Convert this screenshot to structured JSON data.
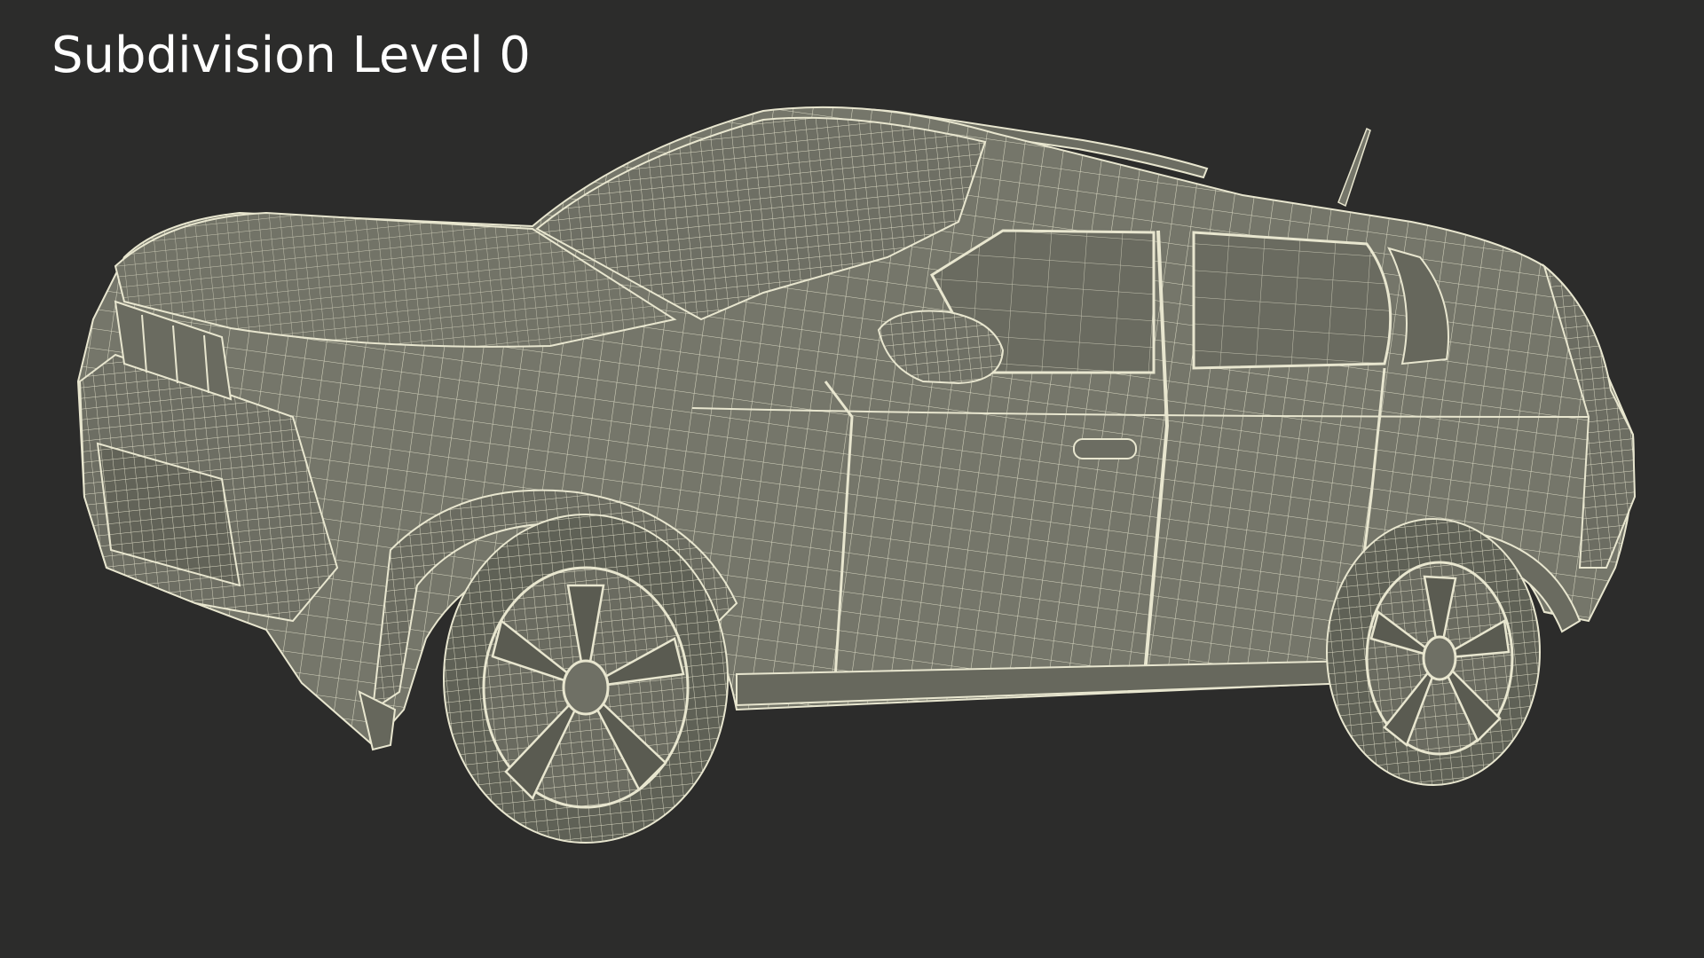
{
  "caption": "Subdivision Level 0",
  "colors": {
    "background": "#2c2c2b",
    "surface": "#75766a",
    "surface_dark": "#5f6156",
    "wire": "#e8e6cf",
    "caption": "#ffffff"
  },
  "icons": {
    "subject": "car-wireframe-icon"
  }
}
